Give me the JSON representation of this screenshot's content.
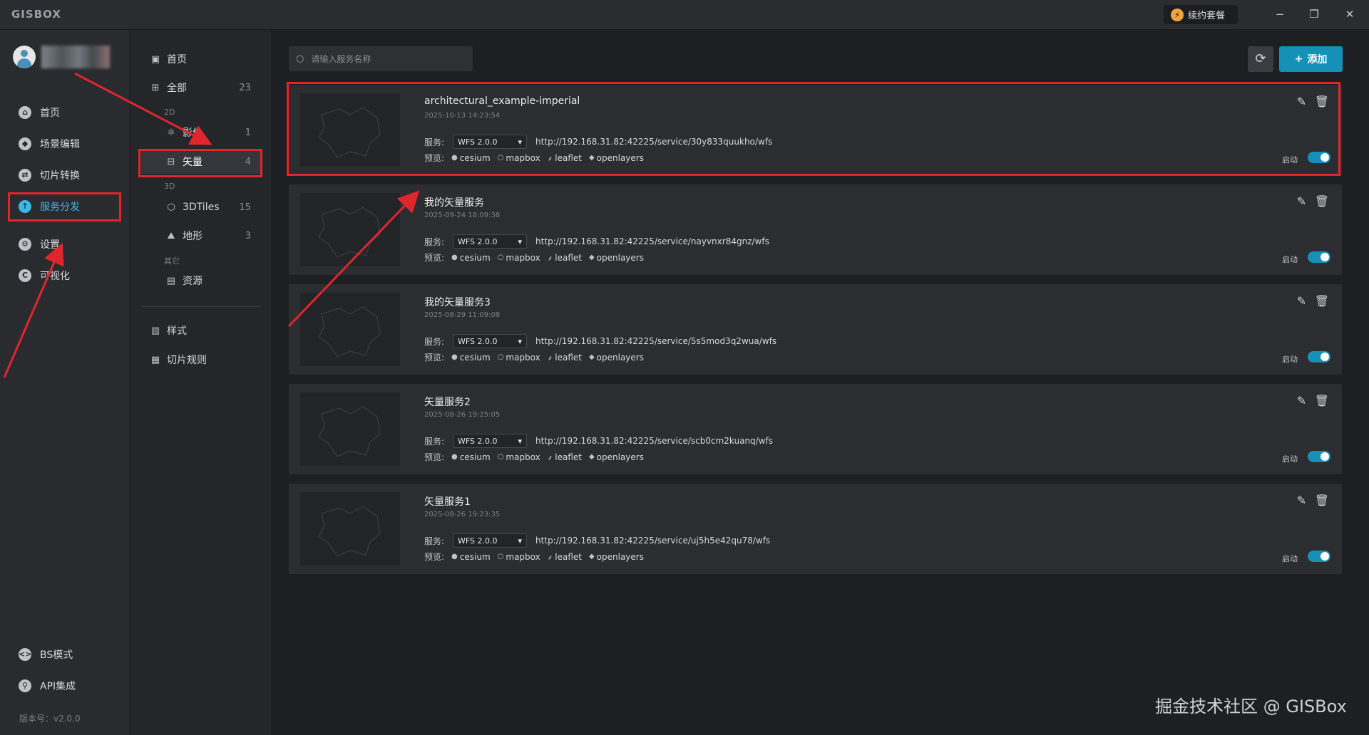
{
  "app": {
    "logo": "GISBOX"
  },
  "titlebar": {
    "renew_label": "续约套餐",
    "minimize": "−",
    "restore": "❐",
    "close": "✕"
  },
  "user": {
    "name_blurred": ""
  },
  "leftnav": {
    "items": [
      {
        "label": "首页",
        "icon": "home-icon"
      },
      {
        "label": "场景编辑",
        "icon": "cube-icon"
      },
      {
        "label": "切片转换",
        "icon": "swap-icon"
      },
      {
        "label": "服务分发",
        "icon": "upload-icon",
        "active": true
      },
      {
        "label": "设置",
        "icon": "gear-icon"
      },
      {
        "label": "可视化",
        "icon": "chart-icon"
      }
    ],
    "bottom": [
      {
        "label": "BS模式",
        "icon": "code-icon"
      },
      {
        "label": "API集成",
        "icon": "api-icon"
      }
    ],
    "version": "版本号：v2.0.0"
  },
  "subnav": {
    "home": "首页",
    "all": {
      "label": "全部",
      "count": "23"
    },
    "group_2d": "2D",
    "imagery": {
      "label": "影像",
      "count": "1"
    },
    "vector": {
      "label": "矢量",
      "count": "4"
    },
    "group_3d": "3D",
    "tiles3d": {
      "label": "3DTiles",
      "count": "15"
    },
    "terrain": {
      "label": "地形",
      "count": "3"
    },
    "group_other": "其它",
    "resources": {
      "label": "资源"
    },
    "style": {
      "label": "样式"
    },
    "tile_rules": {
      "label": "切片规则"
    }
  },
  "toolbar": {
    "search_placeholder": "请输入服务名称",
    "add_label": "添加"
  },
  "card_labels": {
    "service": "服务:",
    "preview": "预览:",
    "enable": "启动"
  },
  "preview_links": [
    "cesium",
    "mapbox",
    "leaflet",
    "openlayers"
  ],
  "services": [
    {
      "name": "architectural_example-imperial",
      "date": "2025-10-13 14:23:54",
      "version": "WFS 2.0.0",
      "url": "http://192.168.31.82:42225/service/30y833quukho/wfs",
      "enabled": true
    },
    {
      "name": "我的矢量服务",
      "date": "2025-09-24 18:09:38",
      "version": "WFS 2.0.0",
      "url": "http://192.168.31.82:42225/service/nayvnxr84gnz/wfs",
      "enabled": true
    },
    {
      "name": "我的矢量服务3",
      "date": "2025-08-29 11:09:08",
      "version": "WFS 2.0.0",
      "url": "http://192.168.31.82:42225/service/5s5mod3q2wua/wfs",
      "enabled": true
    },
    {
      "name": "矢量服务2",
      "date": "2025-08-26 19:25:05",
      "version": "WFS 2.0.0",
      "url": "http://192.168.31.82:42225/service/scb0cm2kuanq/wfs",
      "enabled": true
    },
    {
      "name": "矢量服务1",
      "date": "2025-08-26 19:23:35",
      "version": "WFS 2.0.0",
      "url": "http://192.168.31.82:42225/service/uj5h5e42qu78/wfs",
      "enabled": true
    }
  ],
  "watermark": "掘金技术社区 @ GISBox",
  "colors": {
    "accent": "#1591b8",
    "annotation": "#e0262c",
    "bg": "#1e1f22"
  }
}
